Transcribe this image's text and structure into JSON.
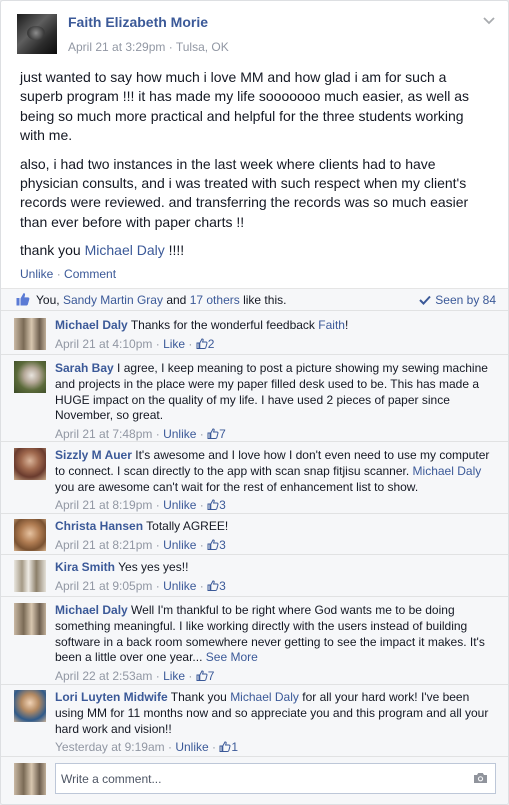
{
  "post": {
    "author": "Faith Elizabeth Morie",
    "date": "April 21 at 3:29pm",
    "location": "Tulsa, OK",
    "separator": "·",
    "body_p1": "just wanted to say how much i love MM and how glad i am for such a superb program !!! it has made my life sooooooo much easier, as well as being so much more practical and helpful for the three students working with me.",
    "body_p2": "also, i had two instances in the last week where clients had to have physician consults, and i was treated with such respect when my client's records were reviewed. and transferring the records was so much easier than ever before with paper charts !!",
    "body_p3_prefix": "thank you",
    "body_p3_mention": "Michael Daly",
    "body_p3_suffix": "!!!!",
    "actions": {
      "unlike": "Unlike",
      "comment": "Comment"
    }
  },
  "likes": {
    "prefix": "You,",
    "name": "Sandy Martin Gray",
    "and": "and",
    "others": "17 others",
    "suffix": "like this.",
    "seen_by": "Seen by 84"
  },
  "comments": [
    {
      "name": "Michael Daly",
      "text": "Thanks for the wonderful feedback",
      "mention": "Faith",
      "text_end": "!",
      "time": "April 21 at 4:10pm",
      "action": "Like",
      "likes": "2"
    },
    {
      "name": "Sarah Bay",
      "text": "I agree, I keep meaning to post a picture showing my sewing machine and projects in the place were my paper filled desk used to be. This has made a HUGE impact on the quality of my life. I have used 2 pieces of paper since November, so great.",
      "time": "April 21 at 7:48pm",
      "action": "Unlike",
      "likes": "7"
    },
    {
      "name": "Sizzly M Auer",
      "text": "It's awesome and I love how I don't even need to use my computer to connect. I scan directly to the app with scan snap fitjisu scanner.",
      "mention": "Michael Daly",
      "text_end": "you are awesome can't wait for the rest of enhancement list to show.",
      "time": "April 21 at 8:19pm",
      "action": "Unlike",
      "likes": "3"
    },
    {
      "name": "Christa Hansen",
      "text": "Totally AGREE!",
      "time": "April 21 at 8:21pm",
      "action": "Unlike",
      "likes": "3"
    },
    {
      "name": "Kira Smith",
      "text": "Yes yes yes!!",
      "time": "April 21 at 9:05pm",
      "action": "Unlike",
      "likes": "3"
    },
    {
      "name": "Michael Daly",
      "text": "Well I'm thankful to be right where God wants me to be doing something meaningful. I like working directly with the users instead of building software in a back room somewhere never getting to see the impact it makes. It's been a little over one year...",
      "see_more": "See More",
      "time": "April 22 at 2:53am",
      "action": "Like",
      "likes": "7"
    },
    {
      "name": "Lori Luyten Midwife",
      "text": "Thank you",
      "mention": "Michael Daly",
      "text_end": "for all your hard work! I've been using MM for 11 months now and so appreciate you and this program and all your hard work and vision!!",
      "time": "Yesterday at 9:19am",
      "action": "Unlike",
      "likes": "1"
    }
  ],
  "composer": {
    "placeholder": "Write a comment..."
  },
  "colors": {
    "link": "#3b5998",
    "meta": "#9197a3",
    "text": "#141823",
    "bar_bg": "#f6f7f9"
  },
  "icons": {
    "chevron": "chevron-down-icon",
    "thumb": "thumbs-up-icon",
    "check": "check-icon",
    "camera": "camera-icon"
  }
}
